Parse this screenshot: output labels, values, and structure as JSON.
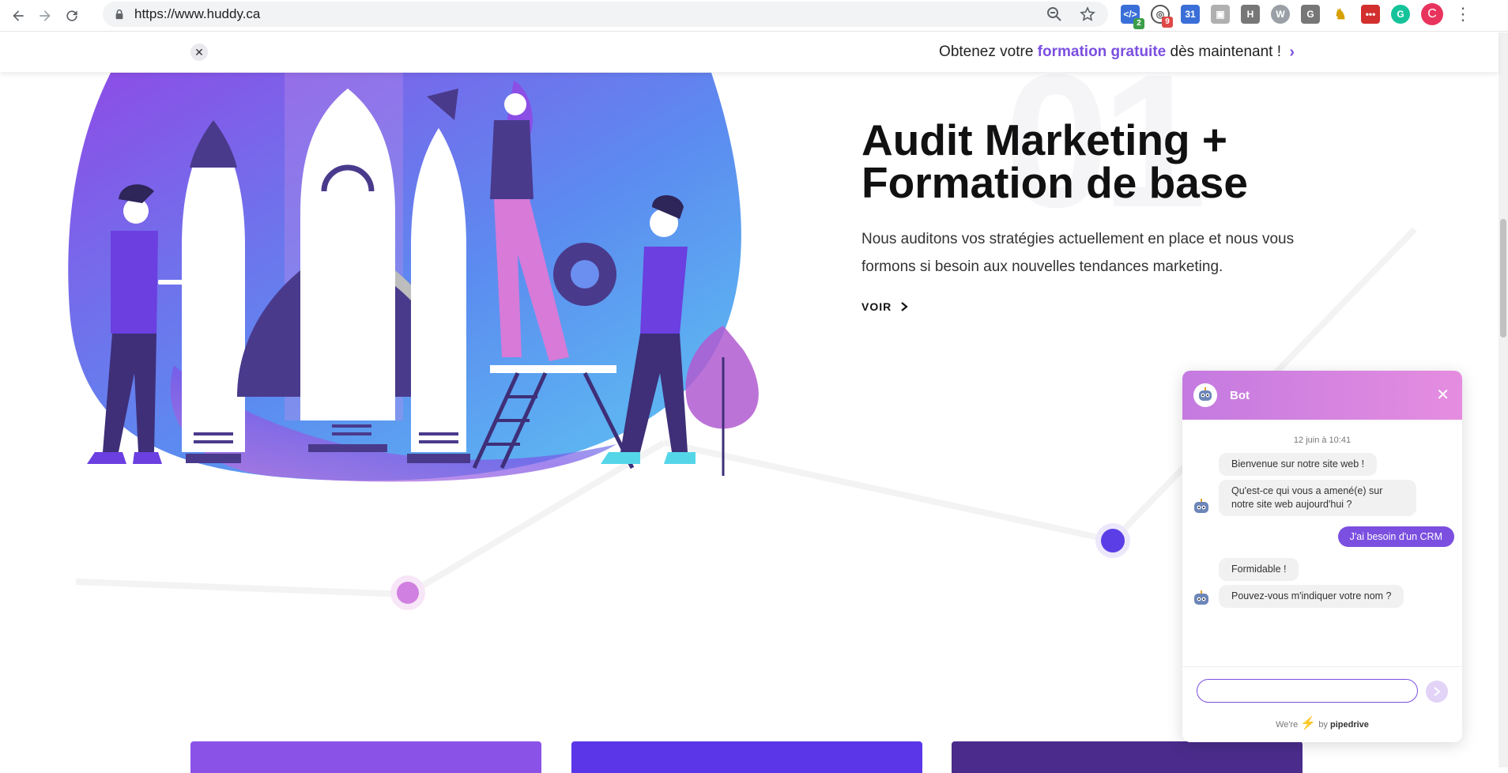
{
  "browser": {
    "url": "https://www.huddy.ca",
    "extensions": [
      {
        "name": "code-extension",
        "badge": "2",
        "color": "#3a6fd8",
        "badge_color": "#3c9e4a"
      },
      {
        "name": "chrome-extension-a",
        "badge": "9",
        "color": "#555555",
        "badge_color": "#e04848"
      },
      {
        "name": "calendar-extension",
        "badge": "",
        "color": "#3a6fd8",
        "badge_color": ""
      },
      {
        "name": "camera-extension",
        "badge": "",
        "color": "#a0a0a0",
        "badge_color": ""
      },
      {
        "name": "h-extension",
        "label": "H",
        "badge": "",
        "color": "#777777",
        "badge_color": ""
      },
      {
        "name": "wordpress-extension",
        "badge": "",
        "color": "#9aa0a6",
        "badge_color": ""
      },
      {
        "name": "g-extension",
        "label": "G",
        "badge": "",
        "color": "#777777",
        "badge_color": ""
      },
      {
        "name": "ghost-extension",
        "badge": "",
        "color": "#d7a000",
        "badge_color": ""
      },
      {
        "name": "red-extension",
        "badge": "",
        "color": "#d32f2f",
        "badge_color": ""
      },
      {
        "name": "grammarly-extension",
        "badge": "",
        "color": "#15c39a",
        "badge_color": ""
      }
    ],
    "profile_initial": "C"
  },
  "promo": {
    "text_before": "Obtenez votre ",
    "text_highlight": "formation gratuite",
    "text_after": " dès maintenant !"
  },
  "hero": {
    "number": "01",
    "title_line1": "Audit Marketing +",
    "title_line2": "Formation de base",
    "description": "Nous auditons vos stratégies actuellement en place et nous vous formons si besoin aux nouvelles tendances marketing.",
    "link_label": "VOIR"
  },
  "cards": [
    {
      "color": "#8b52e8"
    },
    {
      "color": "#5b36e8"
    },
    {
      "color": "#4b2c8c"
    }
  ],
  "chat": {
    "bot_name": "Bot",
    "timestamp": "12 juin à 10:41",
    "messages_1": [
      "Bienvenue sur notre site web !",
      "Qu'est-ce qui vous a amené(e) sur notre site web aujourd'hui ?"
    ],
    "user_reply": "J'ai besoin d'un CRM",
    "messages_2": [
      "Formidable !",
      "Pouvez-vous m'indiquer votre nom ?"
    ],
    "input_placeholder": "",
    "powered_before": "We're",
    "powered_by": "by",
    "powered_brand": "pipedrive"
  },
  "colors": {
    "accent": "#7b4fe0",
    "chat_header": "#d684e0"
  }
}
